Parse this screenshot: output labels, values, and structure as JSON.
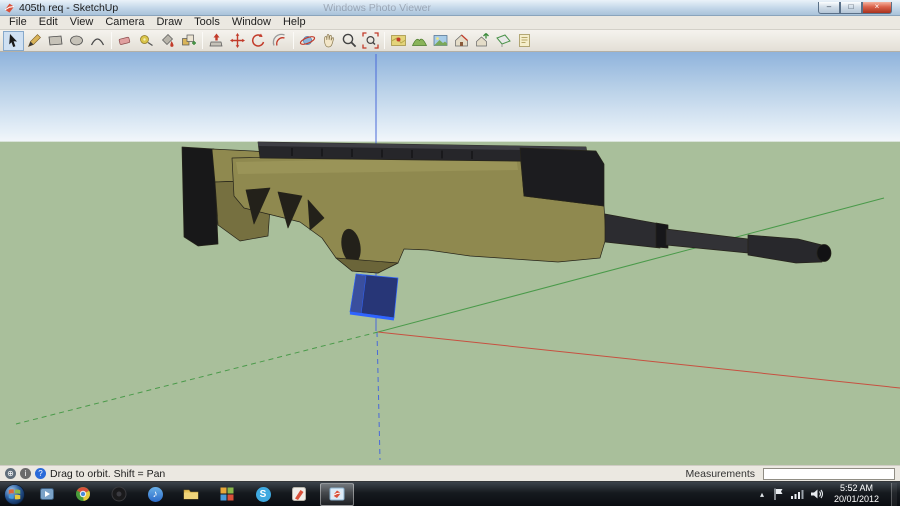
{
  "window": {
    "title": "405th req - SketchUp",
    "ghost_title": "Windows Photo Viewer",
    "controls": [
      {
        "name": "minimize",
        "glyph": "–"
      },
      {
        "name": "maximize",
        "glyph": "□"
      },
      {
        "name": "close",
        "glyph": "×"
      }
    ]
  },
  "menu": {
    "items": [
      "File",
      "Edit",
      "View",
      "Camera",
      "Draw",
      "Tools",
      "Window",
      "Help"
    ]
  },
  "toolbar": {
    "active_tool": "select",
    "tools": [
      "select",
      "line",
      "rectangle",
      "circle",
      "arc",
      "eraser",
      "tape-measure",
      "paint-bucket",
      "make-component",
      "push-pull",
      "move",
      "rotate",
      "offset",
      "orbit",
      "pan",
      "zoom",
      "zoom-extents",
      "add-location",
      "toggle-terrain",
      "photo-textures",
      "get-models",
      "share-model",
      "section-plane",
      "send-to-layout"
    ]
  },
  "viewport": {
    "colors": {
      "sky_top": "#8fb3dc",
      "ground": "#a9bf9b",
      "axis_red": "#c75040",
      "axis_green": "#4a9a4a",
      "axis_blue": "#4a6ad9",
      "model_olive": "#8f894f",
      "model_black": "#1c1c1f",
      "magazine_blue": "#273677",
      "selection_blue": "#2f64ff"
    }
  },
  "statusbar": {
    "icons": [
      {
        "name": "geo-location",
        "glyph": "⊕"
      },
      {
        "name": "credits",
        "glyph": "i"
      },
      {
        "name": "help",
        "glyph": "?"
      }
    ],
    "hint": "Drag to orbit.  Shift = Pan",
    "measurements_label": "Measurements",
    "measurements_value": ""
  },
  "taskbar": {
    "apps": [
      "media-player",
      "chrome",
      "music-app",
      "itunes",
      "explorer",
      "grid-app",
      "skype",
      "photo-editor",
      "sketchup"
    ],
    "active_app": "sketchup",
    "glyphs": {
      "itunes_note": "♪",
      "skype_s": "S",
      "tray_chevron": "▴"
    },
    "clock": {
      "time": "5:52 AM",
      "date": "20/01/2012"
    }
  }
}
